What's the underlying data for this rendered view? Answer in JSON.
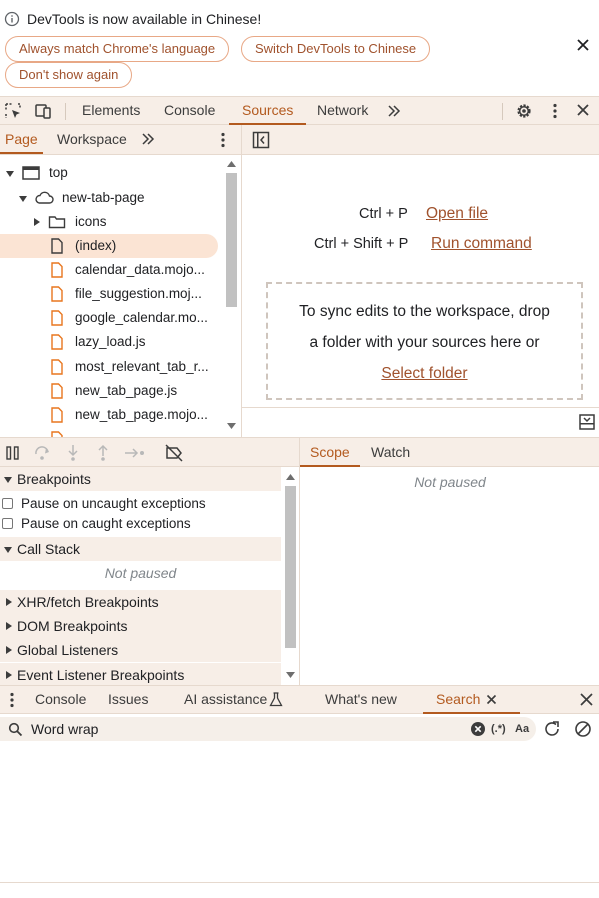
{
  "infobar": {
    "message": "DevTools is now available in Chinese!",
    "buttons": [
      "Always match Chrome's language",
      "Switch DevTools to Chinese",
      "Don't show again"
    ]
  },
  "main_tabs": [
    "Elements",
    "Console",
    "Sources",
    "Network"
  ],
  "active_main_tab": "Sources",
  "navigator": {
    "tabs": [
      "Page",
      "Workspace"
    ],
    "active_tab": "Page",
    "tree": [
      {
        "label": "top",
        "depth": 0,
        "icon": "frame-icon",
        "expanded": true
      },
      {
        "label": "new-tab-page",
        "depth": 1,
        "icon": "cloud-icon",
        "expanded": true
      },
      {
        "label": "icons",
        "depth": 2,
        "icon": "folder-icon",
        "expanded": false
      },
      {
        "label": "(index)",
        "depth": 2,
        "icon": "document-icon",
        "selected": true
      },
      {
        "label": "calendar_data.mojo...",
        "depth": 2,
        "icon": "file-icon"
      },
      {
        "label": "file_suggestion.moj...",
        "depth": 2,
        "icon": "file-icon"
      },
      {
        "label": "google_calendar.mo...",
        "depth": 2,
        "icon": "file-icon"
      },
      {
        "label": "lazy_load.js",
        "depth": 2,
        "icon": "file-icon"
      },
      {
        "label": "most_relevant_tab_r...",
        "depth": 2,
        "icon": "file-icon"
      },
      {
        "label": "new_tab_page.js",
        "depth": 2,
        "icon": "file-icon"
      },
      {
        "label": "new_tab_page.mojo...",
        "depth": 2,
        "icon": "file-icon"
      },
      {
        "label": "...",
        "depth": 2,
        "icon": "file-icon"
      }
    ]
  },
  "editor": {
    "shortcut_1": "Ctrl + P",
    "action_1": "Open file",
    "shortcut_2": "Ctrl + Shift + P",
    "action_2": "Run command",
    "drop_line_1": "To sync edits to the workspace, drop",
    "drop_line_2": "a folder with your sources here or",
    "select_folder": "Select folder"
  },
  "debugger": {
    "breakpoints_title": "Breakpoints",
    "pause_uncaught": "Pause on uncaught exceptions",
    "pause_caught": "Pause on caught exceptions",
    "call_stack_title": "Call Stack",
    "not_paused": "Not paused",
    "collapsed_sections": [
      "XHR/fetch Breakpoints",
      "DOM Breakpoints",
      "Global Listeners",
      "Event Listener Breakpoints"
    ]
  },
  "scope": {
    "tabs": [
      "Scope",
      "Watch"
    ],
    "active_tab": "Scope",
    "status": "Not paused"
  },
  "drawer": {
    "tabs": [
      "Console",
      "Issues",
      "AI assistance",
      "What's new",
      "Search"
    ],
    "active_tab": "Search"
  },
  "search": {
    "value": "Word wrap",
    "regex_label": "(.*)",
    "case_label": "Aa"
  },
  "colors": {
    "accent": "#b35a1f",
    "toolbar_bg": "#f7eee7",
    "selection_bg": "#fbe4d4",
    "file_icon": "#e8761e"
  }
}
